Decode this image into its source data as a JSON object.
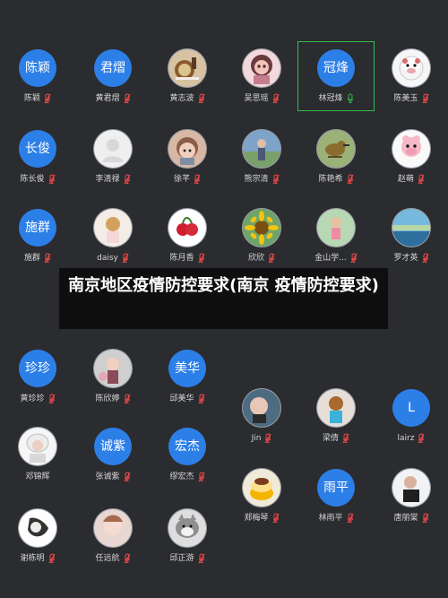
{
  "colors": {
    "background": "#2b2c2f",
    "avatar_blue": "#2d7fe8",
    "mic_red": "#f14a4a",
    "mic_green": "#2fbf4a",
    "overlay_bg": "#0a0a0b"
  },
  "overlay": {
    "title": "南京地区疫情防控要求(南京 疫情防控要求)"
  },
  "participants": [
    {
      "name": "陈颖",
      "avatar_text": "陈颖",
      "avatar_kind": "text",
      "mic": "muted",
      "active": false
    },
    {
      "name": "黄君熠",
      "avatar_text": "君熠",
      "avatar_kind": "text",
      "mic": "muted",
      "active": false
    },
    {
      "name": "黄志波",
      "avatar_text": "",
      "avatar_kind": "photo",
      "mic": "muted",
      "active": false
    },
    {
      "name": "吴思瑶",
      "avatar_text": "",
      "avatar_kind": "photo",
      "mic": "muted",
      "active": false
    },
    {
      "name": "林冠烽",
      "avatar_text": "冠烽",
      "avatar_kind": "text",
      "mic": "active",
      "active": true
    },
    {
      "name": "陈美玉",
      "avatar_text": "",
      "avatar_kind": "photo",
      "mic": "muted",
      "active": false
    },
    {
      "name": "陈长俊",
      "avatar_text": "长俊",
      "avatar_kind": "text",
      "mic": "muted",
      "active": false
    },
    {
      "name": "李清禄",
      "avatar_text": "",
      "avatar_kind": "photo",
      "mic": "muted",
      "active": false
    },
    {
      "name": "徐芊",
      "avatar_text": "",
      "avatar_kind": "photo",
      "mic": "muted",
      "active": false
    },
    {
      "name": "熊宗清",
      "avatar_text": "",
      "avatar_kind": "photo",
      "mic": "muted",
      "active": false
    },
    {
      "name": "陈艳希",
      "avatar_text": "",
      "avatar_kind": "photo",
      "mic": "muted",
      "active": false
    },
    {
      "name": "赵萌",
      "avatar_text": "",
      "avatar_kind": "photo",
      "mic": "muted",
      "active": false
    },
    {
      "name": "施群",
      "avatar_text": "施群",
      "avatar_kind": "text",
      "mic": "muted",
      "active": false
    },
    {
      "name": "daisy",
      "avatar_text": "",
      "avatar_kind": "photo",
      "mic": "muted",
      "active": false
    },
    {
      "name": "陈月香",
      "avatar_text": "",
      "avatar_kind": "photo",
      "mic": "muted",
      "active": false
    },
    {
      "name": "欣欣",
      "avatar_text": "",
      "avatar_kind": "photo",
      "mic": "muted",
      "active": false
    },
    {
      "name": "金山学...",
      "avatar_text": "",
      "avatar_kind": "photo",
      "mic": "muted",
      "active": false
    },
    {
      "name": "罗才英",
      "avatar_text": "",
      "avatar_kind": "photo",
      "mic": "muted",
      "active": false
    },
    {
      "name": "黄珍珍",
      "avatar_text": "珍珍",
      "avatar_kind": "text",
      "mic": "muted",
      "active": false
    },
    {
      "name": "陈欣婷",
      "avatar_text": "",
      "avatar_kind": "photo",
      "mic": "muted",
      "active": false
    },
    {
      "name": "邱美华",
      "avatar_text": "美华",
      "avatar_kind": "text",
      "mic": "muted",
      "active": false
    },
    {
      "name": "Jin",
      "avatar_text": "",
      "avatar_kind": "photo",
      "mic": "muted",
      "active": false
    },
    {
      "name": "梁倩",
      "avatar_text": "",
      "avatar_kind": "photo",
      "mic": "muted",
      "active": false
    },
    {
      "name": "lairz",
      "avatar_text": "L",
      "avatar_kind": "text",
      "mic": "muted",
      "active": false
    },
    {
      "name": "邓锦辉",
      "avatar_text": "",
      "avatar_kind": "photo",
      "mic": "none",
      "active": false
    },
    {
      "name": "张诚紫",
      "avatar_text": "诚紫",
      "avatar_kind": "text",
      "mic": "muted",
      "active": false
    },
    {
      "name": "缪宏杰",
      "avatar_text": "宏杰",
      "avatar_kind": "text",
      "mic": "muted",
      "active": false
    },
    {
      "name": "郑梅琴",
      "avatar_text": "",
      "avatar_kind": "photo",
      "mic": "muted",
      "active": false
    },
    {
      "name": "林雨平",
      "avatar_text": "雨平",
      "avatar_kind": "text",
      "mic": "muted",
      "active": false
    },
    {
      "name": "唐丽棠",
      "avatar_text": "",
      "avatar_kind": "photo",
      "mic": "muted",
      "active": false
    },
    {
      "name": "谢栋明",
      "avatar_text": "",
      "avatar_kind": "photo",
      "mic": "muted",
      "active": false
    },
    {
      "name": "任远航",
      "avatar_text": "",
      "avatar_kind": "photo",
      "mic": "muted",
      "active": false
    },
    {
      "name": "邱正游",
      "avatar_text": "",
      "avatar_kind": "photo",
      "mic": "muted",
      "active": false
    }
  ]
}
